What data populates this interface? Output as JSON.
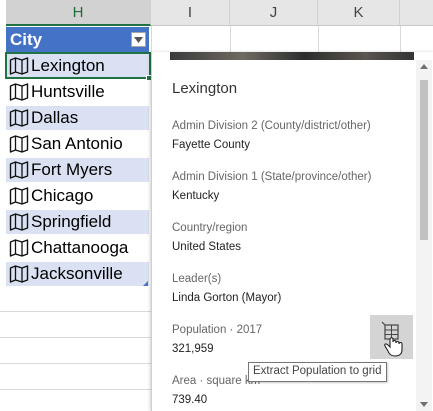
{
  "columns": [
    "H",
    "I",
    "J",
    "K"
  ],
  "table": {
    "header": "City",
    "cities": [
      "Lexington",
      "Huntsville",
      "Dallas",
      "San Antonio",
      "Fort Myers",
      "Chicago",
      "Springfield",
      "Chattanooga",
      "Jacksonville"
    ]
  },
  "card": {
    "title": "Lexington",
    "fields": [
      {
        "label": "Admin Division 2 (County/district/other)",
        "value": "Fayette County"
      },
      {
        "label": "Admin Division 1 (State/province/other)",
        "value": "Kentucky"
      },
      {
        "label": "Country/region",
        "value": "United States"
      },
      {
        "label": "Leader(s)",
        "value": "Linda Gorton (Mayor)"
      },
      {
        "label": "Population · 2017",
        "value": "321,959"
      },
      {
        "label": "Area · square km",
        "value": "739.40"
      }
    ],
    "extract_tooltip": "Extract Population to grid"
  },
  "colors": {
    "table_header": "#4472c4",
    "band": "#d9e1f2",
    "selection": "#217346"
  }
}
